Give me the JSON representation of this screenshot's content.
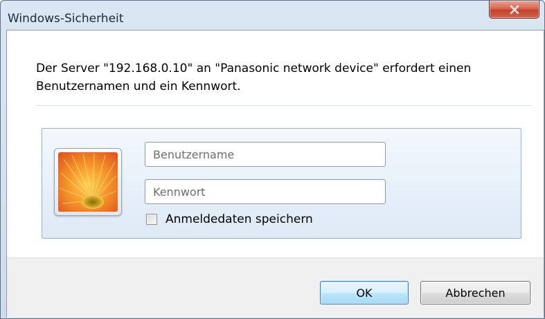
{
  "window": {
    "title": "Windows-Sicherheit"
  },
  "dialog": {
    "message": "Der Server \"192.168.0.10\" an \"Panasonic network device\" erfordert einen Benutzernamen und ein Kennwort."
  },
  "credentials": {
    "username_placeholder": "Benutzername",
    "username_value": "",
    "password_placeholder": "Kennwort",
    "password_value": "",
    "remember_label": "Anmeldedaten speichern",
    "remember_checked": false,
    "user_tile_icon": "flower-user-tile-icon"
  },
  "buttons": {
    "ok_label": "OK",
    "cancel_label": "Abbrechen"
  },
  "colors": {
    "close_button": "#c4432c",
    "ok_button_border": "#3c7fb1",
    "panel_border": "#92b3d6"
  }
}
